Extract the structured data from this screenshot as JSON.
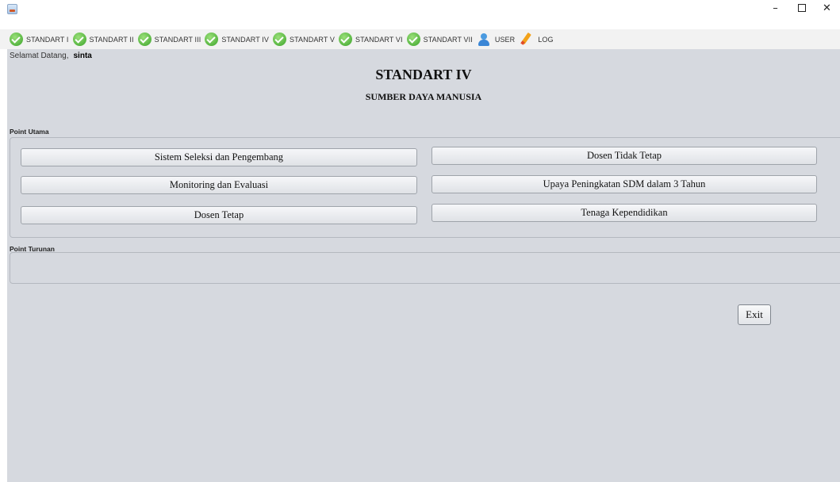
{
  "window": {
    "minimize_glyph": "–",
    "close_glyph": "✕"
  },
  "menubar": {
    "items": [
      {
        "label": "STANDART I",
        "icon": "check-icon"
      },
      {
        "label": "STANDART II",
        "icon": "check-icon"
      },
      {
        "label": "STANDART III",
        "icon": "check-icon"
      },
      {
        "label": "STANDART IV",
        "icon": "check-icon"
      },
      {
        "label": "STANDART V",
        "icon": "check-icon"
      },
      {
        "label": "STANDART VI",
        "icon": "check-icon"
      },
      {
        "label": "STANDART VII",
        "icon": "check-icon"
      },
      {
        "label": "USER",
        "icon": "user-icon"
      },
      {
        "label": "LOG",
        "icon": "pencil-icon"
      }
    ]
  },
  "header": {
    "welcome_text": "Selamat Datang,",
    "username": "sinta",
    "title": "STANDART IV",
    "subtitle": "SUMBER DAYA MANUSIA"
  },
  "point_utama": {
    "label": "Point Utama",
    "buttons": [
      "Sistem Seleksi dan Pengembang",
      "Monitoring dan Evaluasi",
      "Dosen Tetap",
      "Dosen Tidak Tetap",
      "Upaya Peningkatan SDM dalam 3 Tahun",
      "Tenaga Kependidikan"
    ]
  },
  "point_turunan": {
    "label": "Point Turunan"
  },
  "actions": {
    "exit_label": "Exit"
  },
  "colors": {
    "background": "#d6d9df",
    "menubar": "#f2f2f2",
    "check_green": "#3aa329"
  }
}
